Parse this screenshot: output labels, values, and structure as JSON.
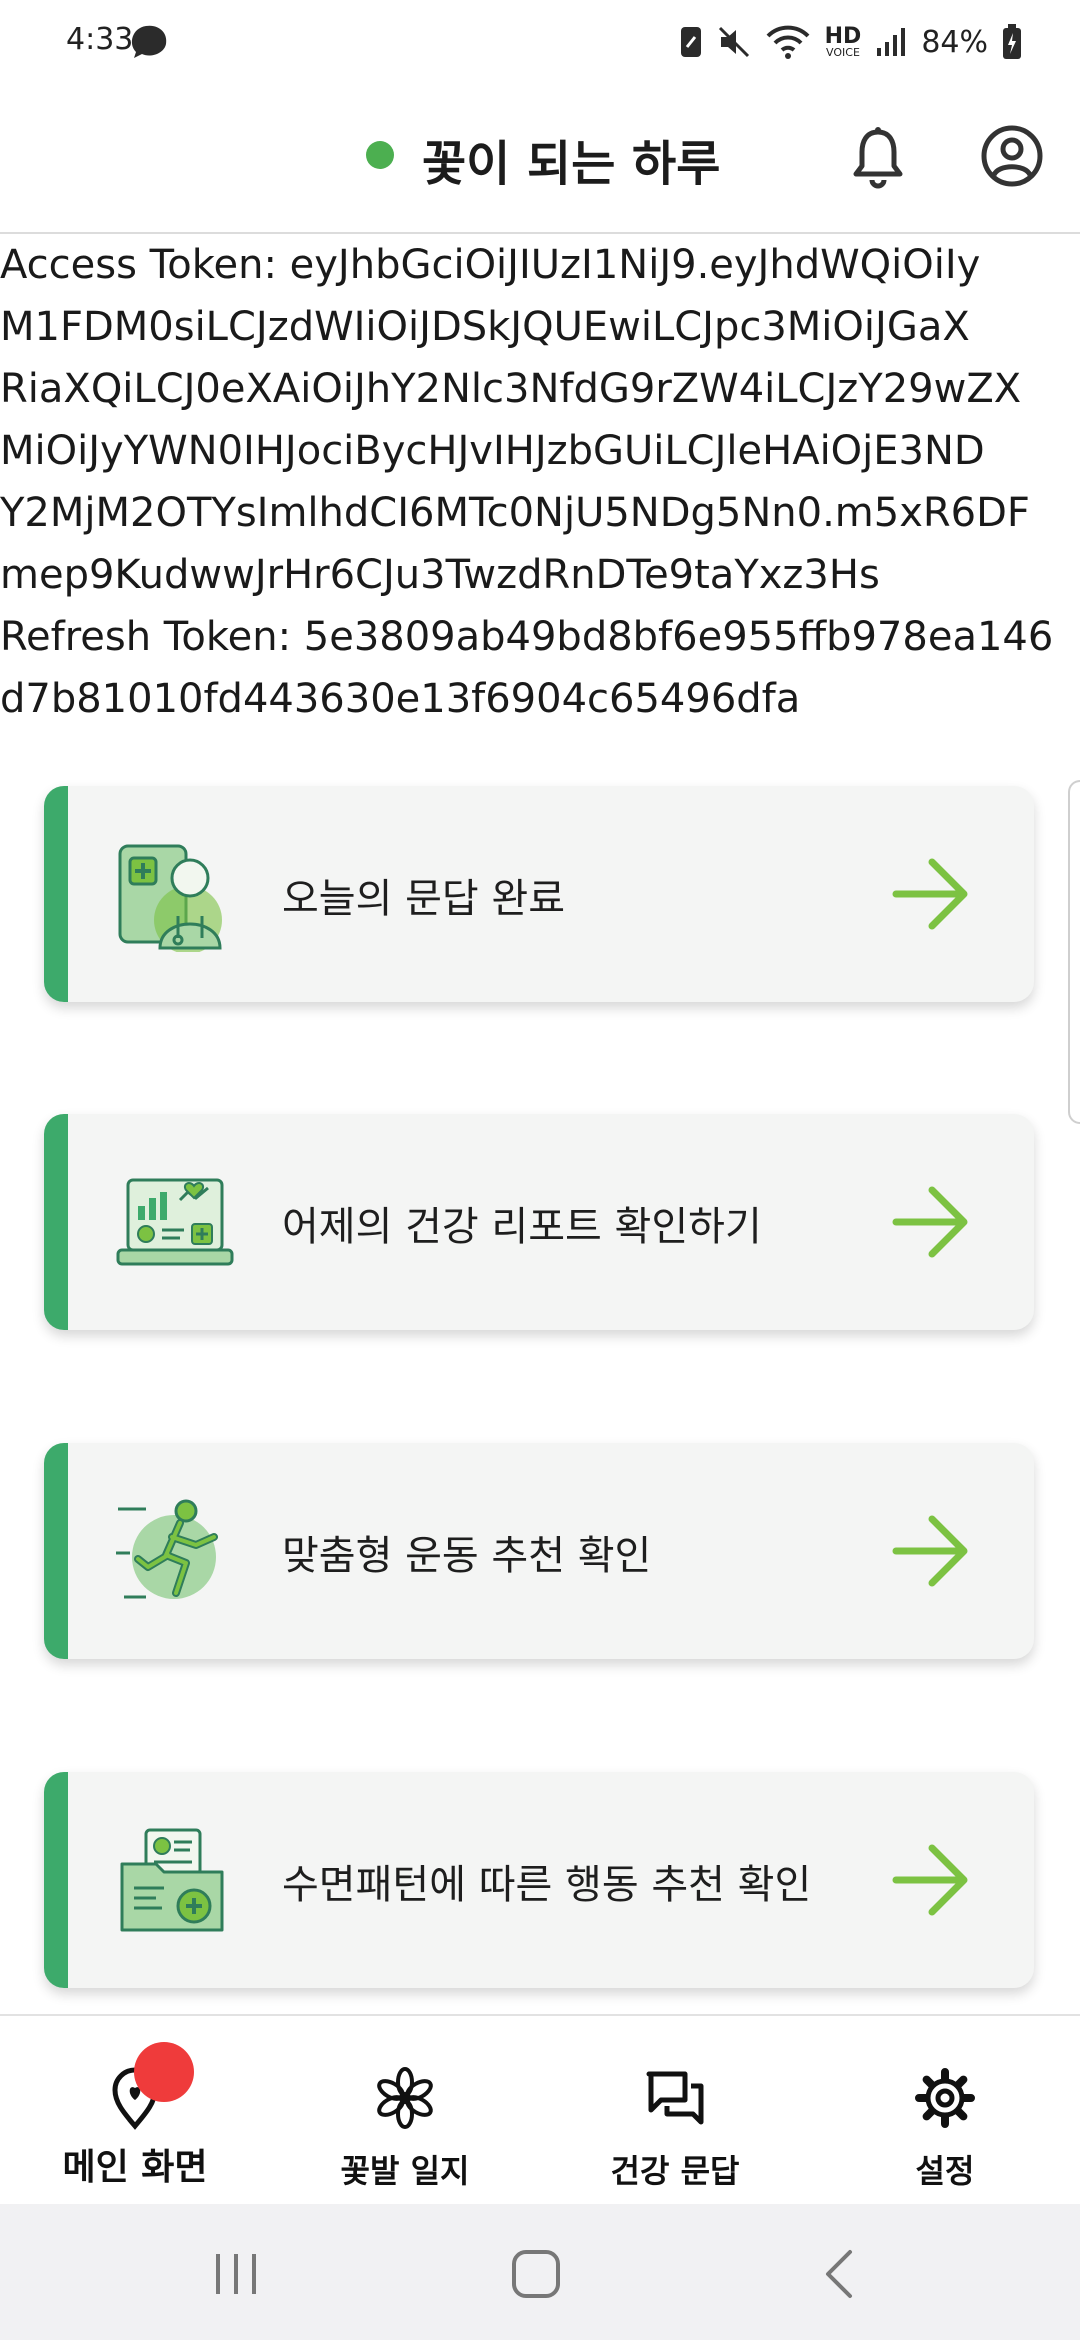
{
  "status_bar": {
    "time": "4:33",
    "hd_label": "HD",
    "hd_sub": "VOICE",
    "battery": "84%"
  },
  "app_bar": {
    "title": "꽃이 되는 하루",
    "status_dot_color": "#4caf50"
  },
  "token_lines": [
    "Access Token: eyJhbGciOiJIUzI1NiJ9.eyJhdWQiOiIy",
    "M1FDM0siLCJzdWIiOiJDSkJQUEwiLCJpc3MiOiJGaX",
    "RiaXQiLCJ0eXAiOiJhY2Nlc3NfdG9rZW4iLCJzY29wZX",
    "MiOiJyYWN0IHJociBycHJvIHJzbGUiLCJleHAiOjE3ND",
    "Y2MjM2OTYsImlhdCI6MTc0NjU5NDg5Nn0.m5xR6DF",
    "mep9KudwwJrHr6CJu3TwzdRnDTe9taYxz3Hs",
    "Refresh Token: 5e3809ab49bd8bf6e955ffb978ea146",
    "d7b81010fd443630e13f6904c65496dfa"
  ],
  "cards": [
    {
      "label": "오늘의 문답 완료",
      "icon": "doctor-chat-icon"
    },
    {
      "label": "어제의 건강 리포트 확인하기",
      "icon": "health-report-laptop-icon"
    },
    {
      "label": "맞춤형 운동 추천 확인",
      "icon": "running-person-icon"
    },
    {
      "label": "수면패턴에 따른 행동 추천 확인",
      "icon": "medical-folder-icon"
    }
  ],
  "colors": {
    "accent": "#3daa6b",
    "arrow": "#7cc242",
    "badge": "#ef3b3b"
  },
  "bottom_nav": [
    {
      "label": "메인 화면",
      "icon": "location-heart-icon",
      "active": true
    },
    {
      "label": "꽃발 일지",
      "icon": "flower-icon",
      "active": false
    },
    {
      "label": "건강 문답",
      "icon": "chat-bubbles-icon",
      "active": false
    },
    {
      "label": "설정",
      "icon": "gear-icon",
      "active": false
    }
  ]
}
